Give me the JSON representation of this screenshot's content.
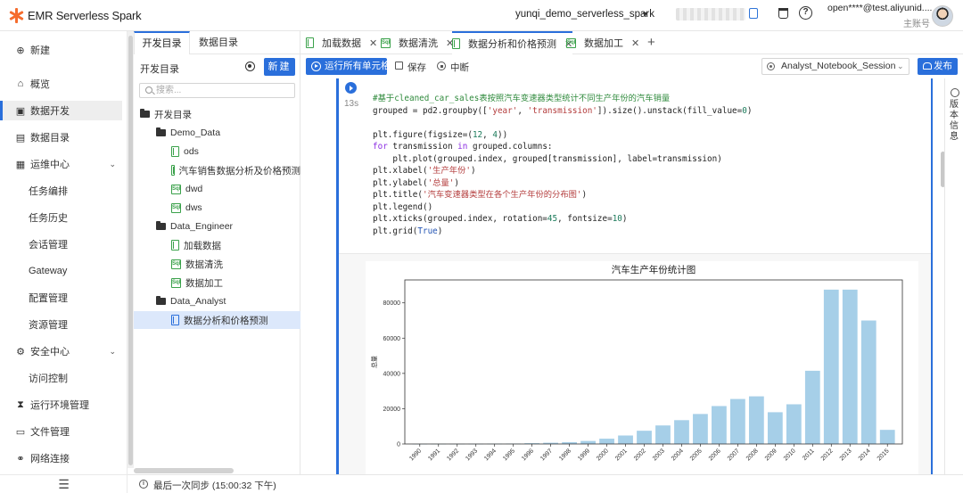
{
  "app": {
    "title": "EMR Serverless Spark"
  },
  "header": {
    "workspace": "yunqi_demo_serverless_spark",
    "user_email": "open****@test.aliyunid....",
    "user_role": "主账号"
  },
  "leftnav": {
    "items": [
      {
        "label": "新建",
        "icon": "plus-circle-icon"
      },
      {
        "label": "概览",
        "icon": "home-icon"
      },
      {
        "label": "数据开发",
        "icon": "terminal-icon",
        "active": true
      },
      {
        "label": "数据目录",
        "icon": "catalog-icon"
      },
      {
        "label": "运维中心",
        "icon": "ops-icon",
        "expandable": true
      },
      {
        "label": "任务编排",
        "sub": true
      },
      {
        "label": "任务历史",
        "sub": true
      },
      {
        "label": "会话管理",
        "sub": true
      },
      {
        "label": "Gateway",
        "sub": true
      },
      {
        "label": "配置管理",
        "sub": true
      },
      {
        "label": "资源管理",
        "sub": true
      },
      {
        "label": "安全中心",
        "icon": "security-icon",
        "expandable": true
      },
      {
        "label": "访问控制",
        "sub": true
      },
      {
        "label": "运行环境管理",
        "icon": "hourglass-icon"
      },
      {
        "label": "文件管理",
        "icon": "file-icon"
      },
      {
        "label": "网络连接",
        "icon": "link-icon"
      }
    ]
  },
  "treepanel": {
    "tabs": [
      "开发目录",
      "数据目录"
    ],
    "title": "开发目录",
    "new_button": "新建",
    "search_placeholder": "搜索...",
    "tree": [
      {
        "label": "开发目录",
        "type": "folder",
        "level": 0
      },
      {
        "label": "Demo_Data",
        "type": "folder",
        "level": 1
      },
      {
        "label": "ods",
        "type": "notebook",
        "level": 2
      },
      {
        "label": "汽车销售数据分析及价格预测",
        "type": "notebook",
        "level": 2
      },
      {
        "label": "dwd",
        "type": "sql",
        "level": 2
      },
      {
        "label": "dws",
        "type": "sql",
        "level": 2
      },
      {
        "label": "Data_Engineer",
        "type": "folder",
        "level": 1
      },
      {
        "label": "加载数据",
        "type": "notebook",
        "level": 2
      },
      {
        "label": "数据清洗",
        "type": "sql",
        "level": 2
      },
      {
        "label": "数据加工",
        "type": "sql",
        "level": 2
      },
      {
        "label": "Data_Analyst",
        "type": "folder",
        "level": 1
      },
      {
        "label": "数据分析和价格预测",
        "type": "notebook",
        "level": 2,
        "selected": true
      }
    ]
  },
  "editor": {
    "tabs": [
      {
        "label": "加载数据",
        "type": "notebook"
      },
      {
        "label": "数据清洗",
        "type": "sql"
      },
      {
        "label": "数据分析和价格预测",
        "type": "notebook",
        "active": true
      },
      {
        "label": "数据加工",
        "type": "sql"
      }
    ],
    "toolbar": {
      "run_all": "运行所有单元格",
      "save": "保存",
      "interrupt": "中断",
      "session": "Analyst_Notebook_Session",
      "publish": "发布"
    },
    "cell": {
      "exec_time": "13s",
      "code_lines": [
        "#基于cleaned_car_sales表按照汽车变速器类型统计不同生产年份的汽车销量",
        "grouped = pd2.groupby(['year', 'transmission']).size().unstack(fill_value=0)",
        "",
        "plt.figure(figsize=(12, 4))",
        "for transmission in grouped.columns:",
        "    plt.plot(grouped.index, grouped[transmission], label=transmission)",
        "plt.xlabel('生产年份')",
        "plt.ylabel('总量')",
        "plt.title('汽车变速器类型在各个生产年份的分布图')",
        "plt.legend()",
        "plt.xticks(grouped.index, rotation=45, fontsize=10)",
        "plt.grid(True)"
      ]
    }
  },
  "rightrail": {
    "version_label": "版本信息"
  },
  "status": {
    "text": "最后一次同步 (15:00:32 下午)"
  },
  "chart_data": {
    "type": "bar",
    "title": "汽车生产年份统计图",
    "xlabel": "",
    "ylabel": "总量",
    "categories": [
      "1990",
      "1991",
      "1992",
      "1993",
      "1994",
      "1995",
      "1996",
      "1997",
      "1998",
      "1999",
      "2000",
      "2001",
      "2002",
      "2003",
      "2004",
      "2005",
      "2006",
      "2007",
      "2008",
      "2009",
      "2010",
      "2011",
      "2012",
      "2013",
      "2014",
      "2015"
    ],
    "values": [
      60,
      80,
      100,
      120,
      180,
      250,
      450,
      700,
      1000,
      1700,
      3000,
      4800,
      7500,
      10500,
      13500,
      17000,
      21500,
      25500,
      27000,
      18000,
      22500,
      41500,
      87500,
      87500,
      70000,
      8000
    ],
    "ylim": [
      0,
      93000
    ],
    "yticks": [
      0,
      20000,
      40000,
      60000,
      80000
    ],
    "bar_color": "#a6cfe8",
    "grid": false
  }
}
